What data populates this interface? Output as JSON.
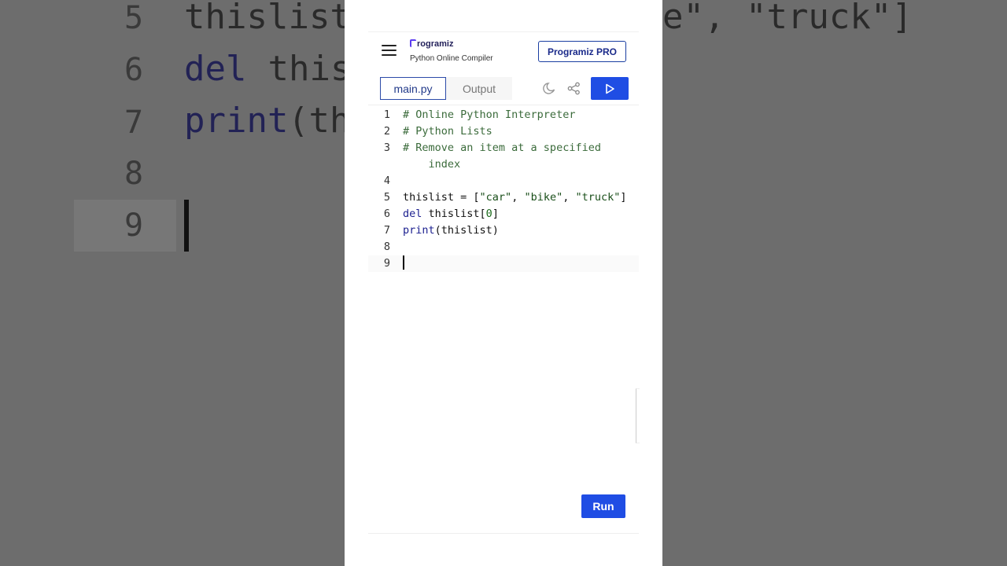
{
  "background": {
    "lines": [
      {
        "num": "5",
        "text": "thislist",
        "tail": "e\", \"truck\"]"
      },
      {
        "num": "6",
        "kw": "del",
        "text": " this"
      },
      {
        "num": "7",
        "kw": "print",
        "text": "(th"
      },
      {
        "num": "8"
      },
      {
        "num": "9"
      }
    ]
  },
  "header": {
    "logo": "rogramiz",
    "subtitle": "Python Online Compiler",
    "pro_label": "Programiz PRO"
  },
  "tabs": {
    "main": "main.py",
    "output": "Output"
  },
  "editor": {
    "lines": [
      {
        "n": "1",
        "text": "# Online Python Interpreter"
      },
      {
        "n": "2",
        "text": "# Python Lists"
      },
      {
        "n": "3",
        "text": "# Remove an item at a specified"
      },
      {
        "n": "",
        "text": "    index"
      },
      {
        "n": "4",
        "text": ""
      },
      {
        "n": "5",
        "text": "thislist = [\"car\", \"bike\", \"truck\"]"
      },
      {
        "n": "6",
        "text": "del thislist[0]"
      },
      {
        "n": "7",
        "text": "print(thislist)"
      },
      {
        "n": "8",
        "text": ""
      },
      {
        "n": "9",
        "text": ""
      }
    ]
  },
  "run_label": "Run",
  "colors": {
    "accent": "#1f4de4",
    "brand": "#23215a"
  }
}
